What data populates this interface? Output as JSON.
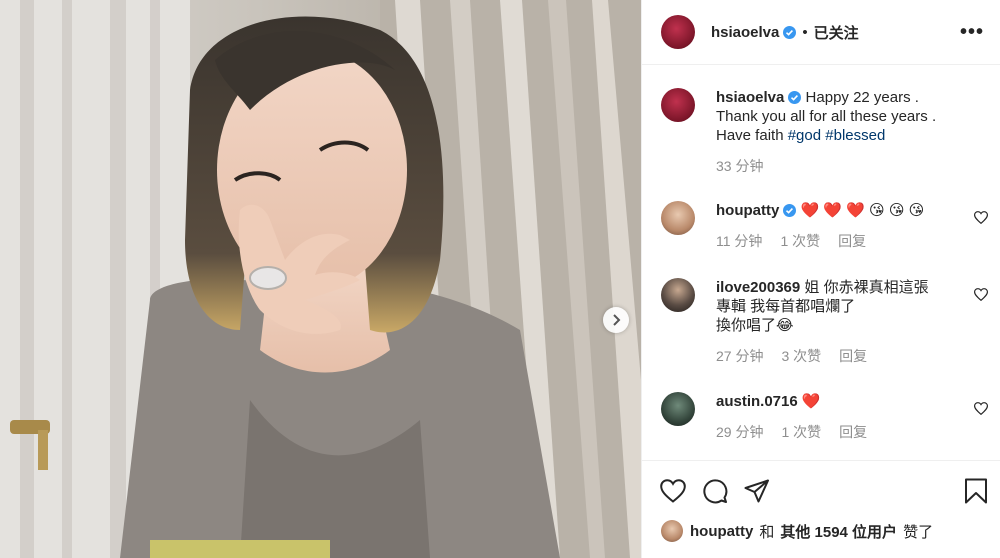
{
  "post": {
    "owner": "hsiaoelva",
    "dot": "•",
    "follow_label": "已关注",
    "more_label": "•••",
    "caption_lines": [
      "Happy 22 years .",
      "Thank you all for all these years .",
      "Have faith"
    ],
    "hashtags": [
      "#god",
      "#blessed"
    ],
    "caption_time": "33 分钟"
  },
  "comments": [
    {
      "user": "houpatty",
      "verified": true,
      "text": "❤️ ❤️ ❤️ 😘 😘 😘",
      "time": "11 分钟",
      "likes": "1 次赞",
      "reply": "回复"
    },
    {
      "user": "ilove200369",
      "verified": false,
      "text_lines": [
        "姐 你赤裸真相這張",
        "專輯 我每首都唱爛了",
        "換你唱了😂"
      ],
      "time": "27 分钟",
      "likes": "3 次赞",
      "reply": "回复"
    },
    {
      "user": "austin.0716",
      "verified": false,
      "text": "❤️",
      "time": "29 分钟",
      "likes": "1 次赞",
      "reply": "回复"
    }
  ],
  "likes_summary": {
    "user": "houpatty",
    "and": "和",
    "others": "其他 1594 位用户",
    "suffix": "赞了"
  },
  "colors": {
    "verified": "#3897f0",
    "hashtag": "#00376b",
    "muted": "#8e8e8e",
    "heart": "#ed4956"
  },
  "icons": [
    "verified-badge-icon",
    "more-options-icon",
    "heart-icon",
    "comment-icon",
    "share-icon",
    "bookmark-icon",
    "chevron-right-icon"
  ]
}
